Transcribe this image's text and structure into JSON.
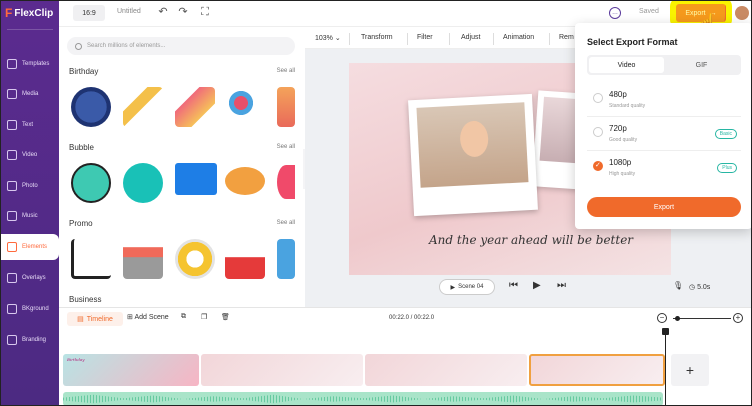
{
  "app": {
    "logo": "FlexClip",
    "logo_mark": "F"
  },
  "sidebar": {
    "items": [
      {
        "label": "Templates"
      },
      {
        "label": "Media"
      },
      {
        "label": "Text"
      },
      {
        "label": "Video"
      },
      {
        "label": "Photo"
      },
      {
        "label": "Music"
      },
      {
        "label": "Elements",
        "active": true
      },
      {
        "label": "Overlays"
      },
      {
        "label": "BKground"
      },
      {
        "label": "Branding"
      }
    ]
  },
  "header": {
    "ratio": "16:9",
    "title": "Untitled",
    "saved": "Saved",
    "export": "Export"
  },
  "panel": {
    "search_placeholder": "Search millions of elements...",
    "see_all": "See all",
    "sections": [
      "Birthday",
      "Bubble",
      "Promo",
      "Business"
    ]
  },
  "toolbar": {
    "zoom": "103%",
    "items": [
      "Transform",
      "Filter",
      "Adjust",
      "Animation",
      "Rem"
    ]
  },
  "canvas": {
    "caption": "And the year ahead will be better"
  },
  "player": {
    "scene": "Scene 04",
    "duration": "5.0s"
  },
  "export_popup": {
    "title": "Select Export Format",
    "tabs": [
      "Video",
      "GIF"
    ],
    "options": [
      {
        "res": "480p",
        "quality": "Standard quality",
        "badge": ""
      },
      {
        "res": "720p",
        "quality": "Good quality",
        "badge": "Basic"
      },
      {
        "res": "1080p",
        "quality": "High quality",
        "badge": "Plus",
        "selected": true
      }
    ],
    "button": "Export"
  },
  "timeline": {
    "tab": "Timeline",
    "add_scene": "Add Scene",
    "time": "00:22.0 / 00:22.0",
    "clip_birthday": "Birthday"
  },
  "colors": {
    "accent": "#f06a2b",
    "sidebar": "#5a2d8c",
    "highlight": "#f8f300"
  }
}
